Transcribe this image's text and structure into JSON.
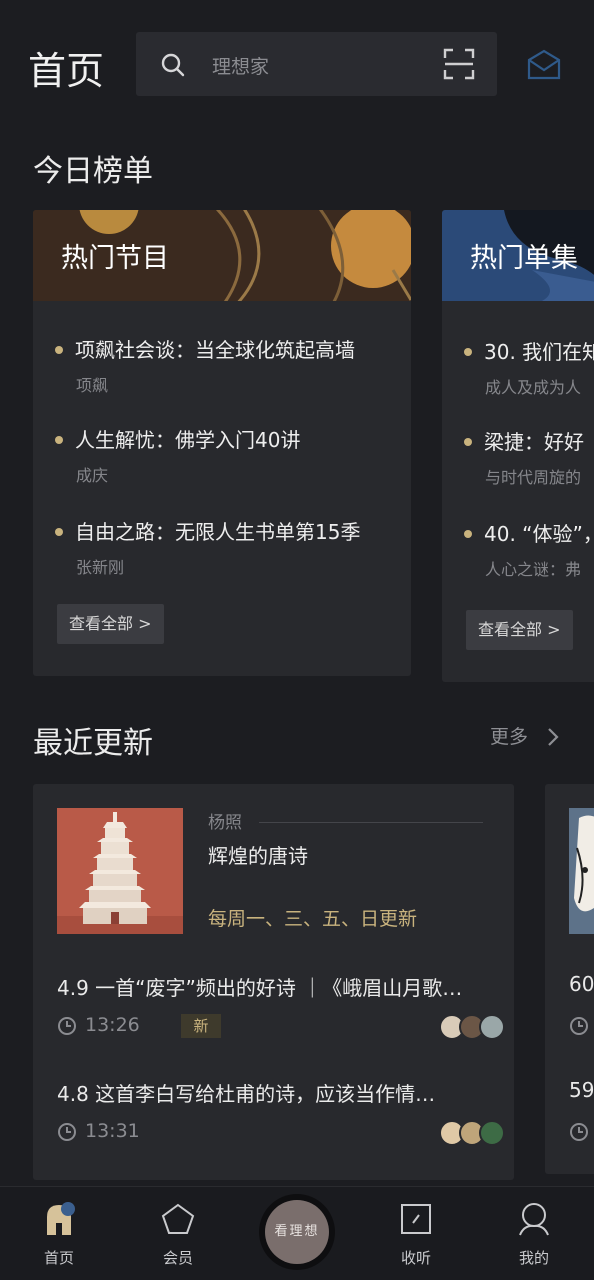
{
  "header": {
    "title": "首页",
    "search_placeholder": "理想家"
  },
  "today_ranking": {
    "title": "今日榜单",
    "cards": [
      {
        "label": "热门节目",
        "items": [
          {
            "title": "项飙社会谈：当全球化筑起高墙",
            "subtitle": "项飙"
          },
          {
            "title": "人生解忧：佛学入门40讲",
            "subtitle": "成庆"
          },
          {
            "title": "自由之路：无限人生书单第15季",
            "subtitle": "张新刚"
          }
        ],
        "view_all": "查看全部 >"
      },
      {
        "label": "热门单集",
        "items": [
          {
            "title": "30. 我们在知",
            "subtitle": "成人及成为人"
          },
          {
            "title": "梁捷：好好",
            "subtitle": "与时代周旋的"
          },
          {
            "title": "40. “体验”，",
            "subtitle": "人心之谜：弗"
          }
        ],
        "view_all": "查看全部 >"
      }
    ]
  },
  "recent_updates": {
    "title": "最近更新",
    "more": "更多",
    "card": {
      "author": "杨照",
      "course": "辉煌的唐诗",
      "schedule": "每周一、三、五、日更新",
      "episodes": [
        {
          "title": "4.9 一首“废字”频出的好诗 ｜《峨眉山月歌…",
          "time": "13:26",
          "badge": "新"
        },
        {
          "title": "4.8 这首李白写给杜甫的诗，应该当作情…",
          "time": "13:31",
          "badge": ""
        }
      ]
    },
    "card2": {
      "ep1": "60",
      "ep2": "59"
    }
  },
  "tabbar": {
    "items": [
      {
        "label": "首页",
        "icon": "home-icon",
        "active": true
      },
      {
        "label": "会员",
        "icon": "member-icon"
      },
      {
        "label": "收听",
        "icon": "listen-icon"
      },
      {
        "label": "我的",
        "icon": "profile-icon"
      }
    ],
    "center": "看理想"
  },
  "colors": {
    "background": "#1c1d21",
    "card": "#28292d",
    "accent_gold": "#c9b37e"
  }
}
